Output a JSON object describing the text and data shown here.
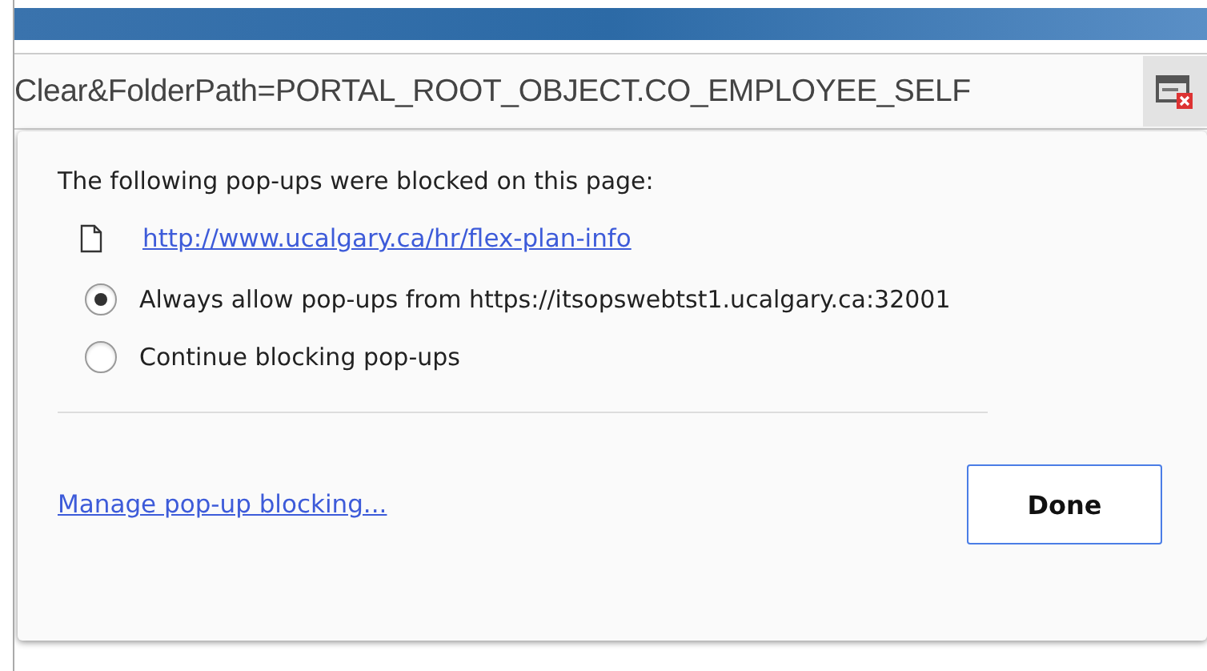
{
  "address_bar": {
    "url": "Clear&FolderPath=PORTAL_ROOT_OBJECT.CO_EMPLOYEE_SELF"
  },
  "popup": {
    "heading": "The following pop-ups were blocked on this page:",
    "blocked_link": "http://www.ucalgary.ca/hr/flex-plan-info",
    "options": [
      {
        "label": "Always allow pop-ups from https://itsopswebtst1.ucalgary.ca:32001",
        "selected": true
      },
      {
        "label": "Continue blocking pop-ups",
        "selected": false
      }
    ],
    "manage_link": "Manage pop-up blocking...",
    "done_button": "Done"
  }
}
